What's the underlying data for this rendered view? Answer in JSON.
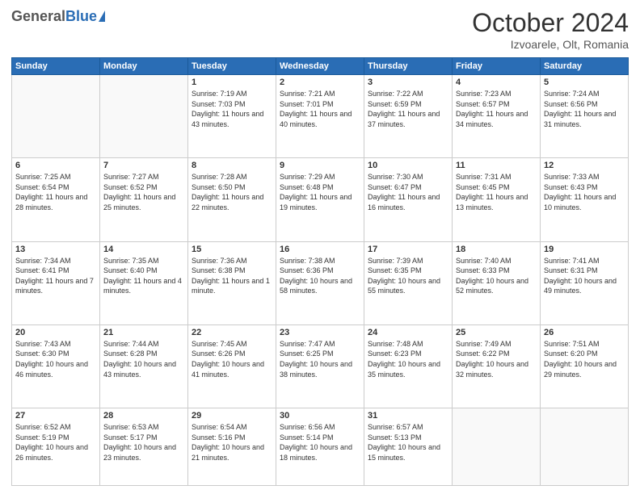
{
  "header": {
    "logo_general": "General",
    "logo_blue": "Blue",
    "month_title": "October 2024",
    "location": "Izvoarele, Olt, Romania"
  },
  "weekdays": [
    "Sunday",
    "Monday",
    "Tuesday",
    "Wednesday",
    "Thursday",
    "Friday",
    "Saturday"
  ],
  "weeks": [
    [
      {
        "day": "",
        "sunrise": "",
        "sunset": "",
        "daylight": ""
      },
      {
        "day": "",
        "sunrise": "",
        "sunset": "",
        "daylight": ""
      },
      {
        "day": "1",
        "sunrise": "Sunrise: 7:19 AM",
        "sunset": "Sunset: 7:03 PM",
        "daylight": "Daylight: 11 hours and 43 minutes."
      },
      {
        "day": "2",
        "sunrise": "Sunrise: 7:21 AM",
        "sunset": "Sunset: 7:01 PM",
        "daylight": "Daylight: 11 hours and 40 minutes."
      },
      {
        "day": "3",
        "sunrise": "Sunrise: 7:22 AM",
        "sunset": "Sunset: 6:59 PM",
        "daylight": "Daylight: 11 hours and 37 minutes."
      },
      {
        "day": "4",
        "sunrise": "Sunrise: 7:23 AM",
        "sunset": "Sunset: 6:57 PM",
        "daylight": "Daylight: 11 hours and 34 minutes."
      },
      {
        "day": "5",
        "sunrise": "Sunrise: 7:24 AM",
        "sunset": "Sunset: 6:56 PM",
        "daylight": "Daylight: 11 hours and 31 minutes."
      }
    ],
    [
      {
        "day": "6",
        "sunrise": "Sunrise: 7:25 AM",
        "sunset": "Sunset: 6:54 PM",
        "daylight": "Daylight: 11 hours and 28 minutes."
      },
      {
        "day": "7",
        "sunrise": "Sunrise: 7:27 AM",
        "sunset": "Sunset: 6:52 PM",
        "daylight": "Daylight: 11 hours and 25 minutes."
      },
      {
        "day": "8",
        "sunrise": "Sunrise: 7:28 AM",
        "sunset": "Sunset: 6:50 PM",
        "daylight": "Daylight: 11 hours and 22 minutes."
      },
      {
        "day": "9",
        "sunrise": "Sunrise: 7:29 AM",
        "sunset": "Sunset: 6:48 PM",
        "daylight": "Daylight: 11 hours and 19 minutes."
      },
      {
        "day": "10",
        "sunrise": "Sunrise: 7:30 AM",
        "sunset": "Sunset: 6:47 PM",
        "daylight": "Daylight: 11 hours and 16 minutes."
      },
      {
        "day": "11",
        "sunrise": "Sunrise: 7:31 AM",
        "sunset": "Sunset: 6:45 PM",
        "daylight": "Daylight: 11 hours and 13 minutes."
      },
      {
        "day": "12",
        "sunrise": "Sunrise: 7:33 AM",
        "sunset": "Sunset: 6:43 PM",
        "daylight": "Daylight: 11 hours and 10 minutes."
      }
    ],
    [
      {
        "day": "13",
        "sunrise": "Sunrise: 7:34 AM",
        "sunset": "Sunset: 6:41 PM",
        "daylight": "Daylight: 11 hours and 7 minutes."
      },
      {
        "day": "14",
        "sunrise": "Sunrise: 7:35 AM",
        "sunset": "Sunset: 6:40 PM",
        "daylight": "Daylight: 11 hours and 4 minutes."
      },
      {
        "day": "15",
        "sunrise": "Sunrise: 7:36 AM",
        "sunset": "Sunset: 6:38 PM",
        "daylight": "Daylight: 11 hours and 1 minute."
      },
      {
        "day": "16",
        "sunrise": "Sunrise: 7:38 AM",
        "sunset": "Sunset: 6:36 PM",
        "daylight": "Daylight: 10 hours and 58 minutes."
      },
      {
        "day": "17",
        "sunrise": "Sunrise: 7:39 AM",
        "sunset": "Sunset: 6:35 PM",
        "daylight": "Daylight: 10 hours and 55 minutes."
      },
      {
        "day": "18",
        "sunrise": "Sunrise: 7:40 AM",
        "sunset": "Sunset: 6:33 PM",
        "daylight": "Daylight: 10 hours and 52 minutes."
      },
      {
        "day": "19",
        "sunrise": "Sunrise: 7:41 AM",
        "sunset": "Sunset: 6:31 PM",
        "daylight": "Daylight: 10 hours and 49 minutes."
      }
    ],
    [
      {
        "day": "20",
        "sunrise": "Sunrise: 7:43 AM",
        "sunset": "Sunset: 6:30 PM",
        "daylight": "Daylight: 10 hours and 46 minutes."
      },
      {
        "day": "21",
        "sunrise": "Sunrise: 7:44 AM",
        "sunset": "Sunset: 6:28 PM",
        "daylight": "Daylight: 10 hours and 43 minutes."
      },
      {
        "day": "22",
        "sunrise": "Sunrise: 7:45 AM",
        "sunset": "Sunset: 6:26 PM",
        "daylight": "Daylight: 10 hours and 41 minutes."
      },
      {
        "day": "23",
        "sunrise": "Sunrise: 7:47 AM",
        "sunset": "Sunset: 6:25 PM",
        "daylight": "Daylight: 10 hours and 38 minutes."
      },
      {
        "day": "24",
        "sunrise": "Sunrise: 7:48 AM",
        "sunset": "Sunset: 6:23 PM",
        "daylight": "Daylight: 10 hours and 35 minutes."
      },
      {
        "day": "25",
        "sunrise": "Sunrise: 7:49 AM",
        "sunset": "Sunset: 6:22 PM",
        "daylight": "Daylight: 10 hours and 32 minutes."
      },
      {
        "day": "26",
        "sunrise": "Sunrise: 7:51 AM",
        "sunset": "Sunset: 6:20 PM",
        "daylight": "Daylight: 10 hours and 29 minutes."
      }
    ],
    [
      {
        "day": "27",
        "sunrise": "Sunrise: 6:52 AM",
        "sunset": "Sunset: 5:19 PM",
        "daylight": "Daylight: 10 hours and 26 minutes."
      },
      {
        "day": "28",
        "sunrise": "Sunrise: 6:53 AM",
        "sunset": "Sunset: 5:17 PM",
        "daylight": "Daylight: 10 hours and 23 minutes."
      },
      {
        "day": "29",
        "sunrise": "Sunrise: 6:54 AM",
        "sunset": "Sunset: 5:16 PM",
        "daylight": "Daylight: 10 hours and 21 minutes."
      },
      {
        "day": "30",
        "sunrise": "Sunrise: 6:56 AM",
        "sunset": "Sunset: 5:14 PM",
        "daylight": "Daylight: 10 hours and 18 minutes."
      },
      {
        "day": "31",
        "sunrise": "Sunrise: 6:57 AM",
        "sunset": "Sunset: 5:13 PM",
        "daylight": "Daylight: 10 hours and 15 minutes."
      },
      {
        "day": "",
        "sunrise": "",
        "sunset": "",
        "daylight": ""
      },
      {
        "day": "",
        "sunrise": "",
        "sunset": "",
        "daylight": ""
      }
    ]
  ]
}
